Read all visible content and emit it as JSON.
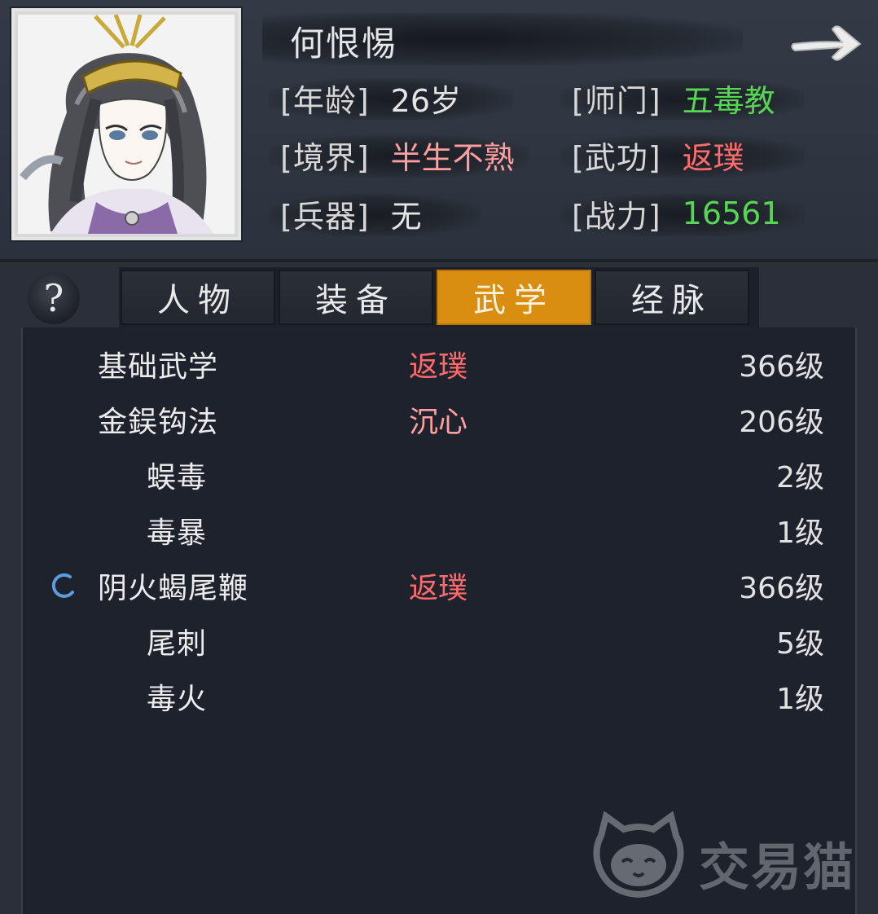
{
  "character": {
    "name": "何恨惕",
    "attributes": [
      {
        "label": "[年龄]",
        "value": "26岁",
        "color": "#e4e4e4"
      },
      {
        "label": "[师门]",
        "value": "五毒教",
        "color": "#57d653"
      },
      {
        "label": "[境界]",
        "value": "半生不熟",
        "color": "#ff9e9e"
      },
      {
        "label": "[武功]",
        "value": "返璞",
        "color": "#ff6a6a"
      },
      {
        "label": "[兵器]",
        "value": "无",
        "color": "#e4e4e4"
      },
      {
        "label": "[战力]",
        "value": "16561",
        "color": "#57d653"
      }
    ]
  },
  "help_icon": "question-mark",
  "next_icon": "arrow-right",
  "tabs": [
    {
      "label": "人物",
      "active": false
    },
    {
      "label": "装备",
      "active": false
    },
    {
      "label": "武学",
      "active": true
    },
    {
      "label": "经脉",
      "active": false
    }
  ],
  "skills": [
    {
      "name": "基础武学",
      "tag": "返璞",
      "tag_color": "#ff6a6a",
      "level": "366级",
      "indent": false,
      "equipped": false
    },
    {
      "name": "金鋘钩法",
      "tag": "沉心",
      "tag_color": "#ff9e9e",
      "level": "206级",
      "indent": false,
      "equipped": false
    },
    {
      "name": "蜈毒",
      "tag": "",
      "tag_color": "",
      "level": "2级",
      "indent": true,
      "equipped": false
    },
    {
      "name": "毒暴",
      "tag": "",
      "tag_color": "",
      "level": "1级",
      "indent": true,
      "equipped": false
    },
    {
      "name": "阴火蝎尾鞭",
      "tag": "返璞",
      "tag_color": "#ff6a6a",
      "level": "366级",
      "indent": false,
      "equipped": true
    },
    {
      "name": "尾刺",
      "tag": "",
      "tag_color": "",
      "level": "5级",
      "indent": true,
      "equipped": false
    },
    {
      "name": "毒火",
      "tag": "",
      "tag_color": "",
      "level": "1级",
      "indent": true,
      "equipped": false
    }
  ],
  "watermark": {
    "text": "交易猫"
  },
  "colors": {
    "accent_tab": "#d98e11",
    "background": "#2a2f3a",
    "panel": "#1e222c"
  }
}
